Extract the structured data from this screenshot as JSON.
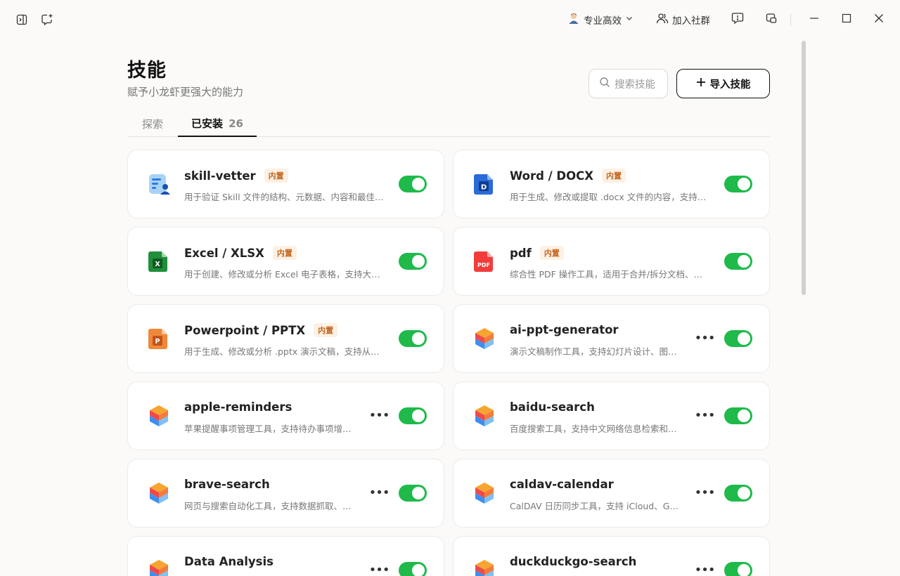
{
  "titlebar": {
    "mode_label": "专业高效",
    "community_label": "加入社群"
  },
  "header": {
    "title": "技能",
    "subtitle": "赋予小龙虾更强大的能力",
    "search_placeholder": "搜索技能",
    "import_label": "导入技能"
  },
  "tabs": [
    {
      "label": "探索"
    },
    {
      "label": "已安装",
      "count": "26"
    }
  ],
  "skills": [
    {
      "name": "skill-vetter",
      "badge": "内置",
      "desc": "用于验证 Skill 文件的结构、元数据、内容和最佳实践",
      "icon": "vetter-icon",
      "enabled": true
    },
    {
      "name": "Word / DOCX",
      "badge": "内置",
      "desc": "用于生成、修改或提取 .docx 文件的内容，支持从头创建",
      "icon": "word-icon",
      "enabled": true
    },
    {
      "name": "Excel / XLSX",
      "badge": "内置",
      "desc": "用于创建、修改或分析 Excel 电子表格，支持大规模数据",
      "icon": "excel-icon",
      "enabled": true
    },
    {
      "name": "pdf",
      "badge": "内置",
      "desc": "综合性 PDF 操作工具，适用于合并/拆分文档、提取文本",
      "icon": "pdf-icon",
      "enabled": true
    },
    {
      "name": "Powerpoint / PPTX",
      "badge": "内置",
      "desc": "用于生成、修改或分析 .pptx 演示文稿，支持从头构建",
      "icon": "pptx-icon",
      "enabled": true
    },
    {
      "name": "ai-ppt-generator",
      "badge": "",
      "desc": "演示文稿制作工具，支持幻灯片设计、图表生成",
      "icon": "cube-icon",
      "enabled": true
    },
    {
      "name": "apple-reminders",
      "badge": "",
      "desc": "苹果提醒事项管理工具，支持待办事项增删改查",
      "icon": "cube-icon",
      "enabled": true
    },
    {
      "name": "baidu-search",
      "badge": "",
      "desc": "百度搜索工具，支持中文网络信息检索和实时查询",
      "icon": "cube-icon",
      "enabled": true
    },
    {
      "name": "brave-search",
      "badge": "",
      "desc": "网页与搜索自动化工具，支持数据抓取、页面交互",
      "icon": "cube-icon",
      "enabled": true
    },
    {
      "name": "caldav-calendar",
      "badge": "",
      "desc": "CalDAV 日历同步工具，支持 iCloud、Google 日历",
      "icon": "cube-icon",
      "enabled": true
    },
    {
      "name": "Data Analysis",
      "badge": "",
      "desc": "",
      "icon": "cube-icon",
      "enabled": true
    },
    {
      "name": "duckduckgo-search",
      "badge": "",
      "desc": "",
      "icon": "cube-icon",
      "enabled": true
    }
  ],
  "colors": {
    "toggle_on": "#1fba4a",
    "badge_text": "#c4661f",
    "badge_bg": "#fdf1e4"
  }
}
